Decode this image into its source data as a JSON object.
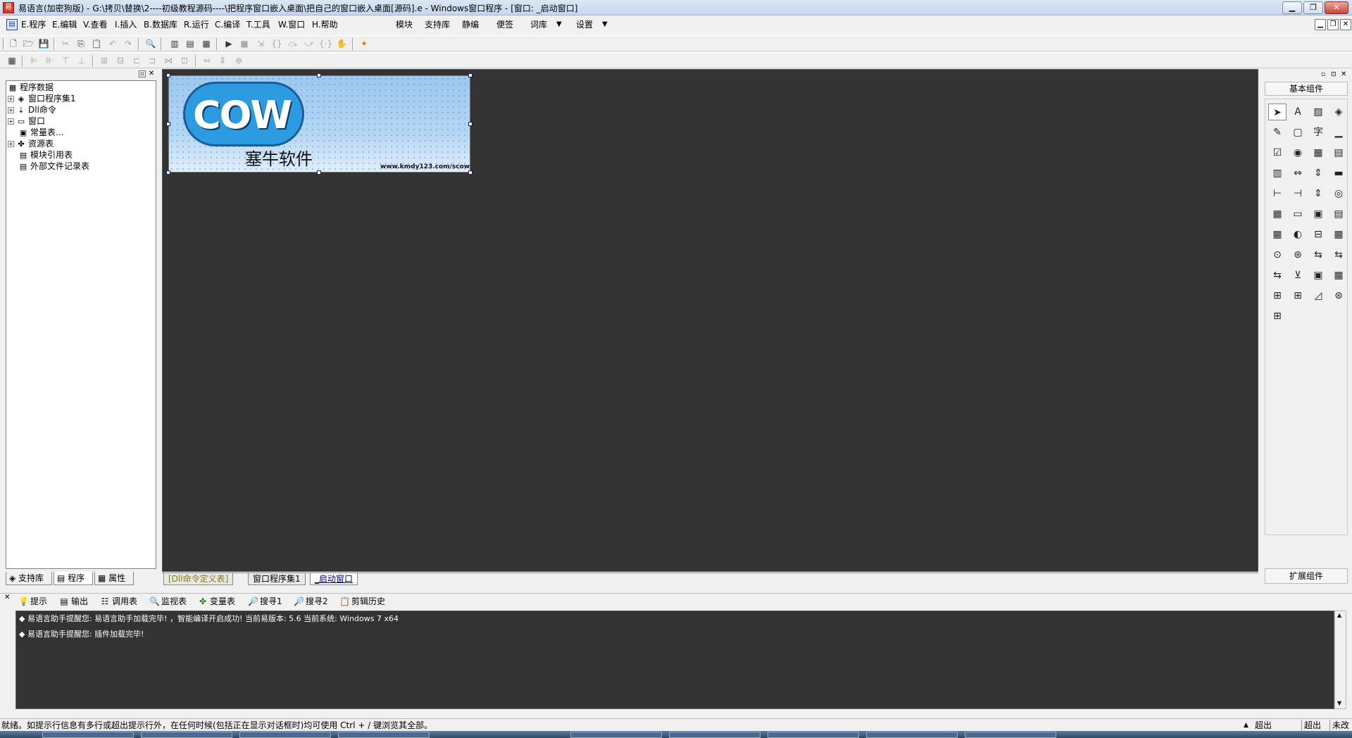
{
  "window": {
    "icon_label": "易",
    "title": "易语言(加密狗版) - G:\\拷贝\\替换\\2----初级教程源码----\\把程序窗口嵌入桌面\\把自己的窗口嵌入桌面[源码].e - Windows窗口程序 - [窗口: _启动窗口]",
    "min_label": "▁",
    "max_label": "❐",
    "close_label": "✕"
  },
  "menubar": {
    "items": [
      "E.程序",
      "E.编辑",
      "V.查看",
      "I.插入",
      "B.数据库",
      "R.运行",
      "C.编译",
      "T.工具",
      "W.窗口",
      "H.帮助"
    ],
    "extras": [
      "模块",
      "支持库",
      "静编",
      "便签",
      "词库",
      "设置"
    ],
    "mdi": [
      "▁",
      "❐",
      "✕"
    ]
  },
  "left_panel": {
    "tree": [
      {
        "label": "程序数据",
        "icon": "▦",
        "expander": ""
      },
      {
        "label": "窗口程序集1",
        "icon": "◈",
        "expander": "+"
      },
      {
        "label": "Dll命令",
        "icon": "⇣",
        "expander": "+"
      },
      {
        "label": "窗口",
        "icon": "▭",
        "expander": "+"
      },
      {
        "label": "常量表...",
        "icon": "▣",
        "expander": ""
      },
      {
        "label": "资源表",
        "icon": "✤",
        "expander": "+"
      },
      {
        "label": "模块引用表",
        "icon": "▤",
        "expander": ""
      },
      {
        "label": "外部文件记录表",
        "icon": "▤",
        "expander": ""
      }
    ],
    "tabs": [
      "支持库",
      "程序",
      "属性"
    ]
  },
  "designer": {
    "form_logo_text": "COW",
    "form_subtitle": "塞牛软件",
    "form_url": "www.kmdy123.com/scow"
  },
  "doc_tabs": [
    "[Dll命令定义表]",
    "窗口程序集1",
    "_启动窗口"
  ],
  "right_panel": {
    "title": "基本组件",
    "extension": "扩展组件",
    "components": [
      "➤",
      "A",
      "▨",
      "◈",
      "✎",
      "▢",
      "字",
      "▁",
      "☑",
      "◉",
      "▦",
      "▤",
      "▥",
      "⇔",
      "⇕",
      "▬",
      "⊢",
      "⊣",
      "⇕",
      "◎",
      "▦",
      "▭",
      "▣",
      "▤",
      "▦",
      "◐",
      "⊟",
      "▦",
      "⊙",
      "⊛",
      "⇆",
      "⇆",
      "⇆",
      "⊻",
      "▣",
      "▦",
      "⊞",
      "⊞",
      "◿",
      "⊛",
      "⊞"
    ]
  },
  "output_tabs": [
    "提示",
    "输出",
    "调用表",
    "监视表",
    "变量表",
    "搜寻1",
    "搜寻2",
    "剪辑历史"
  ],
  "output_lines": [
    "◆ 易语言助手提醒您: 易语言助手加载完毕! ，智能编译开启成功! 当前易版本: 5.6 当前系统: Windows 7 x64",
    "◆ 易语言助手提醒您: 插件加载完毕!"
  ],
  "status": {
    "message": "就绪。如提示行信息有多行或超出提示行外，在任何时候(包括正在显示对话框时)均可使用 Ctrl + / 键浏览其全部。",
    "cells": [
      "超出",
      "超出",
      "未改"
    ]
  }
}
